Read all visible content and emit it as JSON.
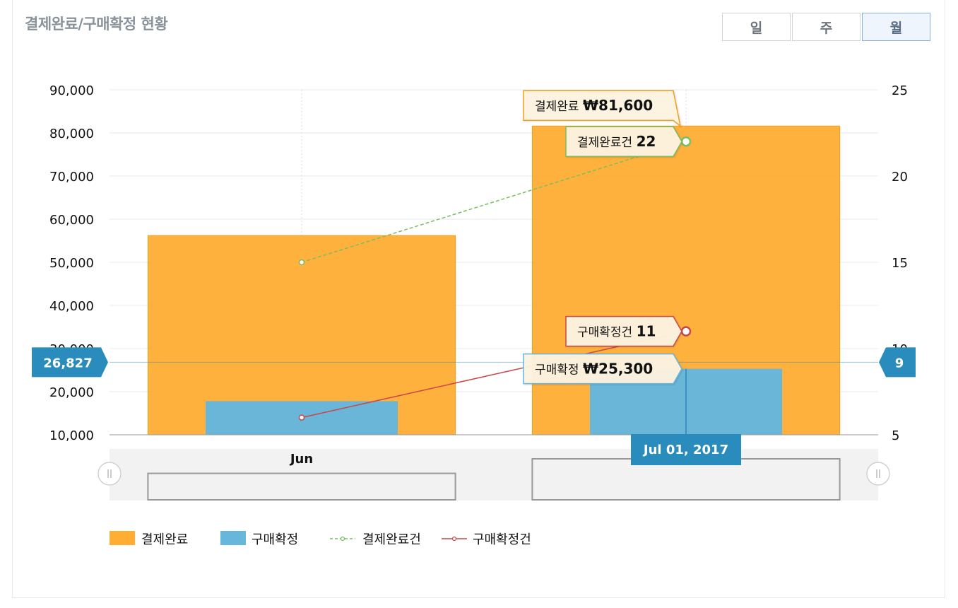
{
  "header": {
    "title": "결제완료/구매확정 현황",
    "period_buttons": [
      {
        "label": "일",
        "active": false
      },
      {
        "label": "주",
        "active": false
      },
      {
        "label": "월",
        "active": true
      }
    ]
  },
  "chart_data": {
    "type": "bar",
    "categories": [
      "Jun",
      "Jul 01, 2017"
    ],
    "category_axis_labels": [
      "Jun",
      ""
    ],
    "series": [
      {
        "name": "결제완료",
        "kind": "bar",
        "axis": "left",
        "color": "#ffad33",
        "values": [
          56200,
          81600
        ]
      },
      {
        "name": "구매확정",
        "kind": "bar",
        "axis": "left",
        "color": "#67b6dc",
        "values": [
          17800,
          25300
        ]
      },
      {
        "name": "결제완료건",
        "kind": "line",
        "dashed": true,
        "axis": "right",
        "color": "#7bbd5f",
        "values": [
          15,
          22
        ]
      },
      {
        "name": "구매확정건",
        "kind": "line",
        "dashed": false,
        "axis": "right",
        "color": "#c9474a",
        "values": [
          6,
          11
        ]
      }
    ],
    "left_axis": {
      "range": [
        10000,
        90000
      ],
      "ticks": [
        "10,000",
        "20,000",
        "30,000",
        "40,000",
        "50,000",
        "60,000",
        "70,000",
        "80,000",
        "90,000"
      ]
    },
    "right_axis": {
      "range": [
        5,
        25
      ],
      "ticks": [
        "5",
        "10",
        "15",
        "20",
        "25"
      ]
    },
    "grid": true,
    "legend_position": "bottom-left",
    "cursor": {
      "category": "Jul 01, 2017",
      "left_value_label": "26,827",
      "right_value_label": "9"
    },
    "tooltips": [
      {
        "series": "결제완료",
        "label": "결제완료",
        "value": "₩81,600"
      },
      {
        "series": "결제완료건",
        "label": "결제완료건",
        "value": "22"
      },
      {
        "series": "구매확정건",
        "label": "구매확정건",
        "value": "11"
      },
      {
        "series": "구매확정",
        "label": "구매확정",
        "value": "₩25,300"
      }
    ],
    "scrollbar": {
      "preview_values": [
        56200,
        81600
      ]
    }
  }
}
